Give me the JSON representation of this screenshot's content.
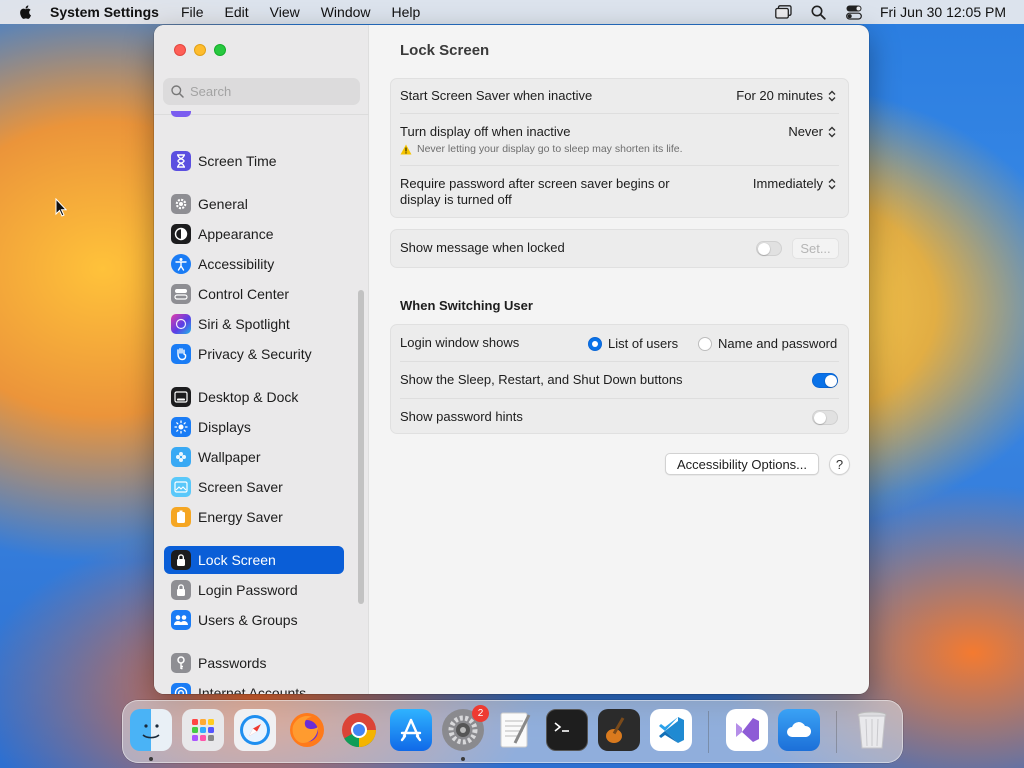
{
  "menubar": {
    "app_name": "System Settings",
    "menus": [
      "File",
      "Edit",
      "View",
      "Window",
      "Help"
    ],
    "clock": "Fri Jun 30  12:05 PM"
  },
  "sidebar": {
    "search_placeholder": "Search",
    "items": [
      {
        "label": "Screen Time",
        "icon": "hourglass-icon",
        "color": "#5b4fe0"
      },
      {
        "label": "General",
        "icon": "gear-icon",
        "color": "#8e8e93"
      },
      {
        "label": "Appearance",
        "icon": "appearance-icon",
        "color": "#1c1c1e"
      },
      {
        "label": "Accessibility",
        "icon": "accessibility-icon",
        "color": "#1a7cf5"
      },
      {
        "label": "Control Center",
        "icon": "control-center-icon",
        "color": "#8e8e93"
      },
      {
        "label": "Siri & Spotlight",
        "icon": "siri-icon",
        "color": "#7b3fe4"
      },
      {
        "label": "Privacy & Security",
        "icon": "hand-icon",
        "color": "#1a7cf5"
      },
      {
        "label": "Desktop & Dock",
        "icon": "dock-icon",
        "color": "#1c1c1e"
      },
      {
        "label": "Displays",
        "icon": "displays-icon",
        "color": "#1a7cf5"
      },
      {
        "label": "Wallpaper",
        "icon": "wallpaper-icon",
        "color": "#39a9f4"
      },
      {
        "label": "Screen Saver",
        "icon": "screen-saver-icon",
        "color": "#5ac8fa"
      },
      {
        "label": "Energy Saver",
        "icon": "battery-icon",
        "color": "#f5a623"
      },
      {
        "label": "Lock Screen",
        "icon": "lock-icon",
        "color": "#1c1c1e"
      },
      {
        "label": "Login Password",
        "icon": "lock-icon",
        "color": "#8e8e93"
      },
      {
        "label": "Users & Groups",
        "icon": "users-icon",
        "color": "#1a7cf5"
      },
      {
        "label": "Passwords",
        "icon": "key-icon",
        "color": "#8e8e93"
      },
      {
        "label": "Internet Accounts",
        "icon": "at-icon",
        "color": "#1a7cf5"
      }
    ],
    "selected": "Lock Screen"
  },
  "content": {
    "title": "Lock Screen",
    "screen_saver_label": "Start Screen Saver when inactive",
    "screen_saver_value": "For 20 minutes",
    "display_off_label": "Turn display off when inactive",
    "display_off_value": "Never",
    "display_off_warning": "Never letting your display go to sleep may shorten its life.",
    "require_password_label_1": "Require password after screen saver begins or",
    "require_password_label_2": "display is turned off",
    "require_password_value": "Immediately",
    "show_message_label": "Show message when locked",
    "show_message_on": false,
    "set_button": "Set...",
    "switching_title": "When Switching User",
    "login_window_label": "Login window shows",
    "login_option_1": "List of users",
    "login_option_2": "Name and password",
    "login_selected": "List of users",
    "sleep_buttons_label": "Show the Sleep, Restart, and Shut Down buttons",
    "sleep_buttons_on": true,
    "password_hints_label": "Show password hints",
    "password_hints_on": false,
    "accessibility_button": "Accessibility Options...",
    "help_button": "?"
  },
  "dock": {
    "apps": [
      "Finder",
      "Launchpad",
      "Safari",
      "Firefox",
      "Chrome",
      "App Store",
      "System Settings",
      "TextEdit",
      "Terminal",
      "Instruments",
      "Visual Studio Code",
      "Visual Studio",
      "iCloud",
      "Trash"
    ],
    "system_settings_badge": "2"
  },
  "colors": {
    "accent": "#0a5ed7",
    "toggle_on": "#0a72e8"
  }
}
